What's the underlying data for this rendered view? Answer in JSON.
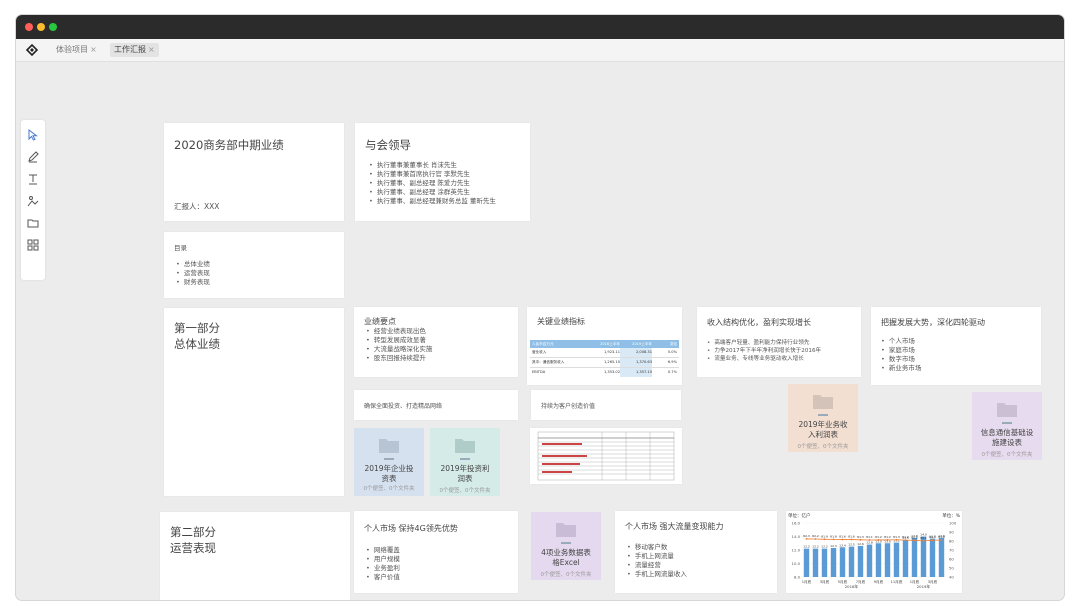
{
  "tabs": [
    {
      "label": "体验项目",
      "close": "×"
    },
    {
      "label": "工作汇报",
      "close": "×"
    }
  ],
  "cover": {
    "title": "2020商务部中期业绩",
    "reporter": "汇报人：XXX"
  },
  "leaders": {
    "title": "与会领导",
    "items": [
      "执行董事兼董事长 肖沫先生",
      "执行董事兼首席执行官 李默先生",
      "执行董事、副总经理 陈爱力先生",
      "执行董事、副总经理 涂群英先生",
      "执行董事、副总经理兼财务总监 董昕先生"
    ]
  },
  "toc": {
    "title": "目录",
    "items": [
      "总体业绩",
      "运营表现",
      "财务表现"
    ]
  },
  "part1": {
    "line1": "第一部分",
    "line2": "总体业绩"
  },
  "part2": {
    "line1": "第二部分",
    "line2": "运营表现"
  },
  "highlights": {
    "title": "业绩要点",
    "items": [
      "经营业绩表现出色",
      "转型发展成效显著",
      "大流量战略深化实施",
      "股东回报持续提升"
    ]
  },
  "kpi": {
    "title": "关键业绩指标",
    "header": [
      "人民币百万元",
      "2018上半年",
      "2019上半年",
      "变化"
    ],
    "rows": [
      [
        "营业收入",
        "1,923.11",
        "2,008.31",
        "5.0%"
      ],
      [
        "其中：通信服务收入",
        "1,265.10",
        "1,370.63",
        "6.9%"
      ],
      [
        "EBITDA",
        "1,353.02",
        "1,357.10",
        "0.7%"
      ]
    ]
  },
  "income": {
    "title": "收入结构优化，盈利实现增长",
    "items": [
      "高端客户轻量、盈利能力保持行业领先",
      "力争2017年下半年净利润增长快于2016年",
      "流量业务、专线等业务驱动收入增长"
    ]
  },
  "trend": {
    "title": "把握发展大势，深化四轮驱动",
    "items": [
      "个人市场",
      "家庭市场",
      "数字市场",
      "新业务市场"
    ]
  },
  "box_a": {
    "text": "确保全面投资、打造精品网络"
  },
  "box_b": {
    "text": "持续为客户创造价值"
  },
  "folders": [
    {
      "name1": "2019年企业投",
      "name2": "资表",
      "meta": "0个便签、0个文件夹"
    },
    {
      "name1": "2019年投资利",
      "name2": "润表",
      "meta": "0个便签、0个文件夹"
    },
    {
      "name1": "2019年业务收",
      "name2": "入利润表",
      "meta": "0个便签、0个文件夹"
    },
    {
      "name1": "信息通信基础设",
      "name2": "施建设表",
      "meta": "0个便签、0个文件夹"
    },
    {
      "name1": "4项业务数据表",
      "name2": "格Excel",
      "meta": "0个便签、0个文件夹"
    }
  ],
  "individual": {
    "title": "个人市场 保持4G领先优势",
    "items": [
      "网络覆盖",
      "用户规模",
      "业务盈利",
      "客户价值"
    ]
  },
  "flow": {
    "title": "个人市场 强大流量变现能力",
    "items": [
      "移动客户数",
      "手机上网流量",
      "流量经营",
      "手机上网流量收入"
    ]
  },
  "chart_data": {
    "type": "bar",
    "left_unit": "单位：亿户",
    "right_unit": "单位：%",
    "categories": [
      "1月底",
      "",
      "3月底",
      "",
      "5月底",
      "",
      "7月底",
      "",
      "9月底",
      "",
      "11月底",
      "",
      "1月底",
      "",
      "3月底",
      ""
    ],
    "year_labels": [
      "2018年",
      "2019年"
    ],
    "values": [
      12.2,
      12.2,
      12.2,
      12.3,
      12.4,
      12.5,
      12.6,
      12.8,
      13.0,
      13.0,
      13.1,
      13.5,
      13.8,
      14.0,
      13.7,
      13.8
    ],
    "line_values": [
      82.3,
      82.2,
      81.9,
      81.8,
      81.6,
      81.6,
      81.3,
      81.1,
      81.2,
      81.2,
      81.3,
      81.0,
      80.6,
      80.1,
      80.9,
      81.0
    ],
    "line_labels": [
      "82.3",
      "82.2",
      "81.9",
      "81.8",
      "81.6",
      "81.6",
      "81.3",
      "81.1",
      "81.2",
      "81.2",
      "81.3",
      "81.0",
      "80.6",
      "80.1",
      "80.9",
      "81.0"
    ],
    "bar_labels": [
      "12.2",
      "12.2",
      "12.2",
      "12.3",
      "12.4",
      "12.5",
      "12.6",
      "12.8",
      "13.0",
      "13.0",
      "13.1",
      "13.5",
      "13.8",
      "14.0",
      "13.7",
      "13.8"
    ],
    "y_ticks": [
      "16.0",
      "14.0",
      "12.0",
      "10.0",
      "8.0"
    ],
    "y2_ticks": [
      "100",
      "90",
      "80",
      "70",
      "60",
      "50",
      "40"
    ],
    "ylim": [
      8,
      16
    ],
    "y2lim": [
      40,
      100
    ],
    "colors": {
      "bar": "#5b9bd5",
      "line": "#ed7d31"
    }
  }
}
